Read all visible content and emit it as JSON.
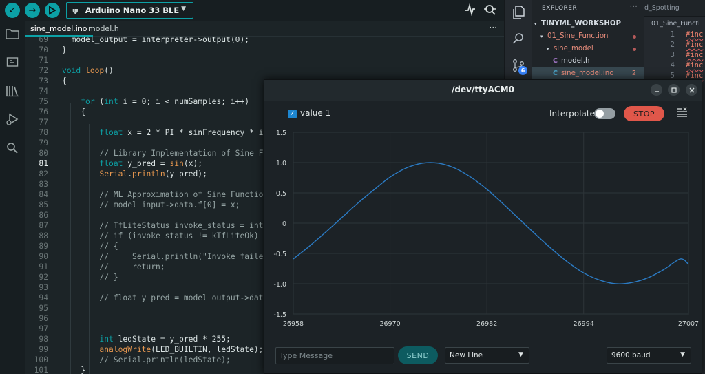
{
  "arduino": {
    "board": "Arduino Nano 33 BLE",
    "tabs": [
      {
        "label": "sine_model.ino",
        "active": true
      },
      {
        "label": "model.h",
        "active": false
      }
    ],
    "tab_menu": "···",
    "code_lines": [
      {
        "n": "69",
        "html": "  model_output = interpreter->output(0);"
      },
      {
        "n": "70",
        "html": "}"
      },
      {
        "n": "71",
        "html": ""
      },
      {
        "n": "72",
        "html": "<span class=\"kw\">void</span> <span class=\"fn\">loop</span>()"
      },
      {
        "n": "73",
        "html": "{"
      },
      {
        "n": "74",
        "html": ""
      },
      {
        "n": "75",
        "html": "    <span class=\"kw\">for</span> (<span class=\"kw\">int</span> i = 0; i &lt; numSamples; i++)"
      },
      {
        "n": "76",
        "html": "    {"
      },
      {
        "n": "77",
        "html": ""
      },
      {
        "n": "78",
        "html": "        <span class=\"kw\">float</span> x = 2 * PI * sinFrequency * i"
      },
      {
        "n": "79",
        "html": ""
      },
      {
        "n": "80",
        "html": "        <span class=\"cm\">// Library Implementation of Sine Fu</span>"
      },
      {
        "n": "81",
        "html": "        <span class=\"kw\">float</span> y_pred = <span class=\"fn\">sin</span>(x);",
        "current": true
      },
      {
        "n": "82",
        "html": "        <span class=\"fn\">Serial</span>.<span class=\"fn\">println</span>(y_pred);"
      },
      {
        "n": "83",
        "html": ""
      },
      {
        "n": "84",
        "html": "        <span class=\"cm\">// ML Approximation of Sine Function</span>"
      },
      {
        "n": "85",
        "html": "        <span class=\"cm\">// model_input-&gt;data.f[0] = x;</span>"
      },
      {
        "n": "86",
        "html": ""
      },
      {
        "n": "87",
        "html": "        <span class=\"cm\">// TfLiteStatus invoke_status = inte</span>"
      },
      {
        "n": "88",
        "html": "        <span class=\"cm\">// if (invoke_status != kTfLiteOk)</span>"
      },
      {
        "n": "89",
        "html": "        <span class=\"cm\">// {</span>"
      },
      {
        "n": "90",
        "html": "        <span class=\"cm\">//     Serial.println(\"Invoke failed</span>"
      },
      {
        "n": "91",
        "html": "        <span class=\"cm\">//     return;</span>"
      },
      {
        "n": "92",
        "html": "        <span class=\"cm\">// }</span>"
      },
      {
        "n": "93",
        "html": ""
      },
      {
        "n": "94",
        "html": "        <span class=\"cm\">// float y_pred = model_output-&gt;data</span>"
      },
      {
        "n": "95",
        "html": ""
      },
      {
        "n": "96",
        "html": ""
      },
      {
        "n": "97",
        "html": ""
      },
      {
        "n": "98",
        "html": "        <span class=\"kw\">int</span> ledState = y_pred * 255;"
      },
      {
        "n": "99",
        "html": "        <span class=\"fn\">analogWrite</span>(LED_BUILTIN, ledState);"
      },
      {
        "n": "100",
        "html": "        <span class=\"cm\">// Serial.println(ledState);</span>"
      },
      {
        "n": "101",
        "html": "    }"
      }
    ]
  },
  "vscode": {
    "explorer_title": "EXPLORER",
    "more": "···",
    "tree": [
      {
        "label": "TINYML_WORKSHOP",
        "indent": 0,
        "chev": "▾",
        "color": "#d4dbe2",
        "bold": true
      },
      {
        "label": "01_Sine_Function",
        "indent": 1,
        "chev": "▾",
        "color": "#e98d7c",
        "dot": true
      },
      {
        "label": "sine_model",
        "indent": 2,
        "chev": "▾",
        "color": "#e98d7c",
        "dot": true
      },
      {
        "label": "model.h",
        "indent": 3,
        "icon": "C",
        "iconColor": "#a074c4",
        "color": "#d4dbe2"
      },
      {
        "label": "sine_model.ino",
        "indent": 3,
        "icon": "C",
        "iconColor": "#4aa3c7",
        "color": "#e98d7c",
        "badge": "2",
        "selected": true
      }
    ],
    "editor_tab": "d_Spotting",
    "breadcrumb": "01_Sine_Functi",
    "editor_lines": [
      {
        "n": "1",
        "text": "#inc"
      },
      {
        "n": "2",
        "text": "#inc"
      },
      {
        "n": "3",
        "text": "#inc"
      },
      {
        "n": "4",
        "text": "#inc"
      },
      {
        "n": "5",
        "text": "#inc"
      }
    ],
    "scm_badge": "6"
  },
  "plotter": {
    "title": "/dev/ttyACM0",
    "legend_label": "value 1",
    "interpolate_label": "Interpolate",
    "stop_label": "STOP",
    "message_placeholder": "Type Message",
    "send_label": "SEND",
    "line_ending": "New Line",
    "baud": "9600 baud"
  },
  "chart_data": {
    "type": "line",
    "series": [
      {
        "name": "value 1",
        "color": "#2b7bc4"
      }
    ],
    "x_ticks": [
      26958,
      26970,
      26982,
      26994,
      27007
    ],
    "y_ticks": [
      "1.5",
      "1.0",
      "0.5",
      "0",
      "-0.5",
      "-1.0",
      "-1.5"
    ],
    "xlim": [
      26958,
      27007
    ],
    "ylim": [
      -1.5,
      1.5
    ],
    "grid": true,
    "x": [
      26958,
      26960,
      26962,
      26964,
      26966,
      26968,
      26970,
      26972,
      26974,
      26976,
      26978,
      26980,
      26982,
      26984,
      26986,
      26988,
      26990,
      26992,
      26994,
      26996,
      26998,
      27000,
      27002,
      27004,
      27006,
      27007
    ],
    "y": [
      -0.59,
      -0.38,
      -0.15,
      0.09,
      0.33,
      0.55,
      0.76,
      0.91,
      0.99,
      0.99,
      0.91,
      0.76,
      0.56,
      0.32,
      0.07,
      -0.18,
      -0.42,
      -0.64,
      -0.82,
      -0.94,
      -1.0,
      -0.98,
      -0.9,
      -0.76,
      -0.59,
      -0.68
    ]
  }
}
